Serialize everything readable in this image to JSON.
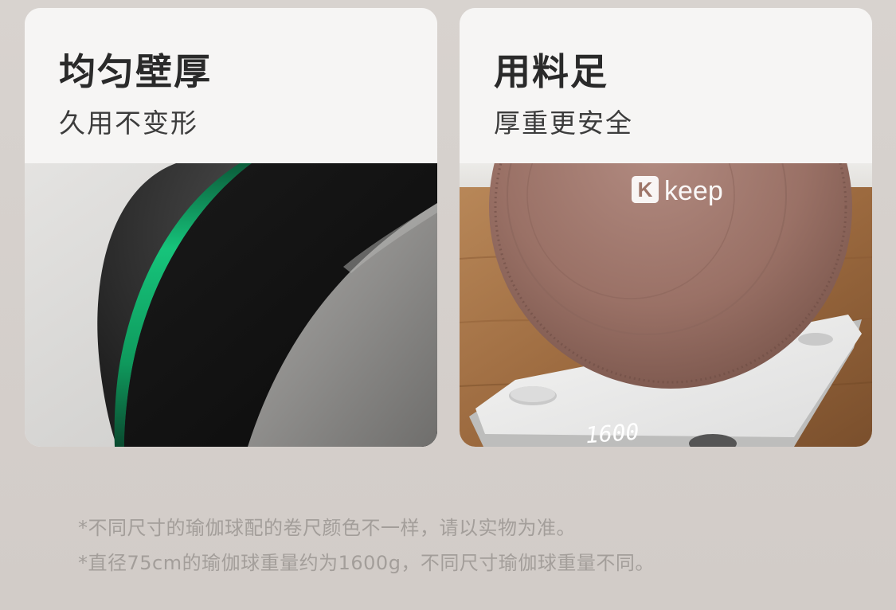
{
  "cards": [
    {
      "title": "均匀壁厚",
      "subtitle": "久用不变形",
      "image": "yoga-ball-cross-section-photo"
    },
    {
      "title": "用料足",
      "subtitle": "厚重更安全",
      "image": "yoga-ball-on-scale-photo",
      "brand": "keep",
      "brand_badge": "K",
      "scale_reading": "1600"
    }
  ],
  "notes": [
    "*不同尺寸的瑜伽球配的卷尺颜色不一样，请以实物为准。",
    "*直径75cm的瑜伽球重量约为1600g，不同尺寸瑜伽球重量不同。"
  ],
  "colors": {
    "page_bg": "#d6d0cc",
    "card_bg": "#f6f5f4",
    "title": "#2a2a2a",
    "note": "#a39e9a",
    "accent_green": "#12b873",
    "ball_pink": "#a77d72"
  }
}
